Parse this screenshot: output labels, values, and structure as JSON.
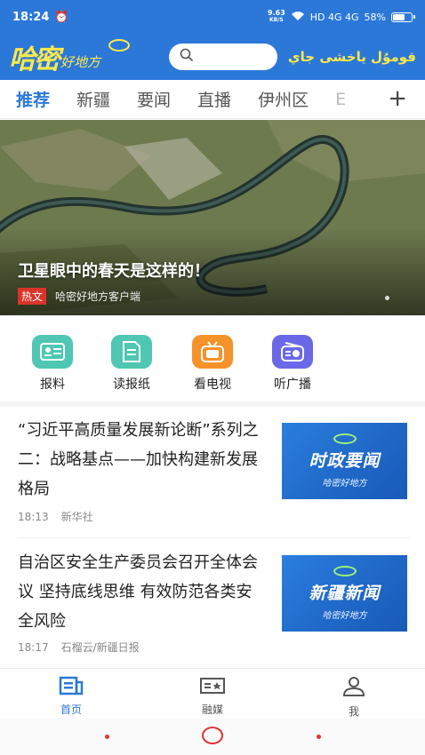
{
  "status_bar": {
    "time": "18:24",
    "speed_top": "9.63",
    "speed_unit": "KB/S",
    "network": "HD 4G 4G",
    "battery": "58%"
  },
  "header": {
    "logo_main": "哈密",
    "logo_sub": "好地方",
    "uyghur_text": "قومۇل ياخشى جاي",
    "search_placeholder": ""
  },
  "tabs": [
    {
      "label": "推荐",
      "active": true
    },
    {
      "label": "新疆"
    },
    {
      "label": "要闻"
    },
    {
      "label": "直播"
    },
    {
      "label": "伊州区"
    },
    {
      "label": "E"
    }
  ],
  "tabs_add": "+",
  "banner": {
    "title": "卫星眼中的春天是这样的！",
    "badge": "热文",
    "source": "哈密好地方客户端"
  },
  "quick_links": [
    {
      "label": "报料",
      "icon": "report-card-icon",
      "color": "#4fc7b2"
    },
    {
      "label": "读报纸",
      "icon": "newspaper-icon",
      "color": "#4fc7b2"
    },
    {
      "label": "看电视",
      "icon": "tv-icon",
      "color": "#f5922a"
    },
    {
      "label": "听广播",
      "icon": "radio-icon",
      "color": "#6b68e8"
    }
  ],
  "news": [
    {
      "title": "“习近平高质量发展新论断”系列之二：战略基点——加快构建新发展格局",
      "time": "18:13",
      "source": "新华社",
      "thumb_title": "时政要闻",
      "thumb_sub": "哈密好地方"
    },
    {
      "title": "自治区安全生产委员会召开全体会议 坚持底线思维 有效防范各类安全风险",
      "time": "18:17",
      "source": "石榴云/新疆日报",
      "thumb_title": "新疆新闻",
      "thumb_sub": "哈密好地方"
    }
  ],
  "bottom_nav": [
    {
      "label": "首页",
      "icon": "home-news-icon",
      "active": true
    },
    {
      "label": "融媒",
      "icon": "media-icon"
    },
    {
      "label": "我",
      "icon": "profile-icon"
    }
  ],
  "colors": {
    "brand": "#2b78d9",
    "logo_yellow": "#ffe84a",
    "hot": "#d9332a",
    "system_nav": "#e03434"
  }
}
